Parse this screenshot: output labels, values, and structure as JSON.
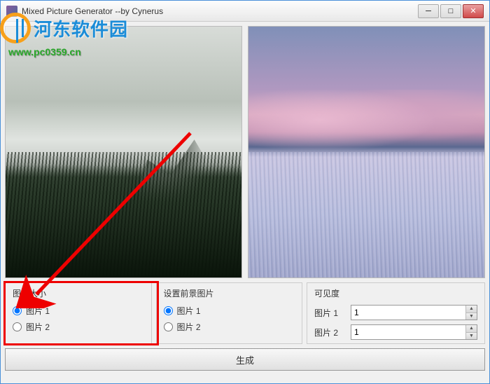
{
  "window": {
    "title": "Mixed Picture Generator     --by Cynerus"
  },
  "watermark": {
    "text": "河东软件园",
    "url": "www.pc0359.cn"
  },
  "groups": {
    "size": {
      "title": "图片大小",
      "options": [
        "图片 1",
        "图片 2"
      ]
    },
    "foreground": {
      "title": "设置前景图片",
      "options": [
        "图片 1",
        "图片 2"
      ]
    },
    "visibility": {
      "title": "可见度",
      "rows": [
        {
          "label": "图片 1",
          "value": "1"
        },
        {
          "label": "图片 2",
          "value": "1"
        }
      ]
    }
  },
  "buttons": {
    "generate": "生成"
  }
}
